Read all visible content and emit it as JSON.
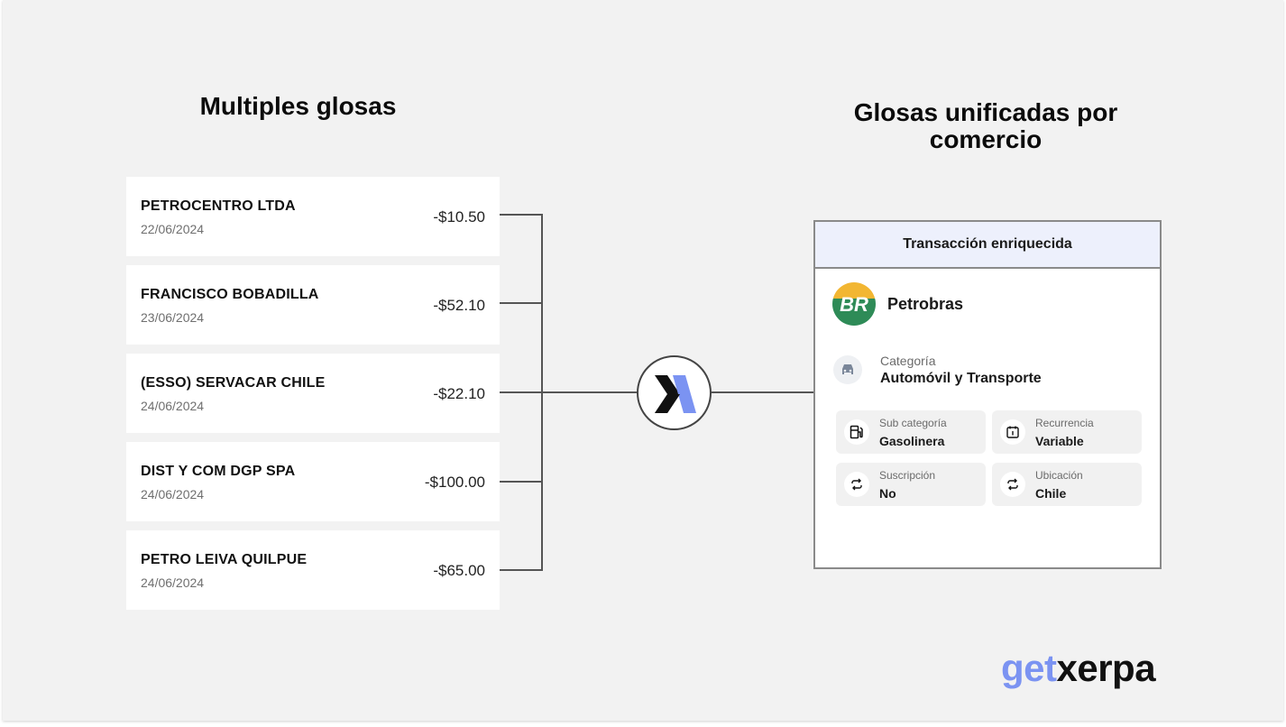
{
  "headings": {
    "left": "Multiples glosas",
    "right": "Glosas unificadas por comercio"
  },
  "transactions": [
    {
      "name": "PETROCENTRO LTDA",
      "date": "22/06/2024",
      "amount": "-$10.50"
    },
    {
      "name": "FRANCISCO BOBADILLA",
      "date": "23/06/2024",
      "amount": "-$52.10"
    },
    {
      "name": "(ESSO) SERVACAR CHILE",
      "date": "24/06/2024",
      "amount": "-$22.10"
    },
    {
      "name": "DIST Y COM DGP SPA",
      "date": "24/06/2024",
      "amount": "-$100.00"
    },
    {
      "name": "PETRO LEIVA QUILPUE",
      "date": "24/06/2024",
      "amount": "-$65.00"
    }
  ],
  "hub": {
    "icon": "xerpa-x-icon"
  },
  "card": {
    "header": "Transacción enriquecida",
    "merchant": {
      "name": "Petrobras",
      "logo_text": "BR",
      "logo_icon": "petrobras-logo"
    },
    "category": {
      "label": "Categoría",
      "value": "Automóvil y Transporte",
      "icon": "car-icon"
    },
    "details": [
      {
        "label": "Sub categoría",
        "value": "Gasolinera",
        "icon": "fuel-pump-icon"
      },
      {
        "label": "Recurrencia",
        "value": "Variable",
        "icon": "calendar-repeat-icon"
      },
      {
        "label": "Suscripción",
        "value": "No",
        "icon": "repeat-icon"
      },
      {
        "label": "Ubicación",
        "value": "Chile",
        "icon": "repeat-icon"
      }
    ]
  },
  "brand": {
    "part1": "get",
    "part2": "xerpa"
  },
  "colors": {
    "background": "#f2f2f2",
    "accent": "#7b93f2",
    "card_header": "#edf0fc",
    "connector": "#555555",
    "petrobras_yellow": "#f2b632",
    "petrobras_green": "#2e8b57"
  }
}
